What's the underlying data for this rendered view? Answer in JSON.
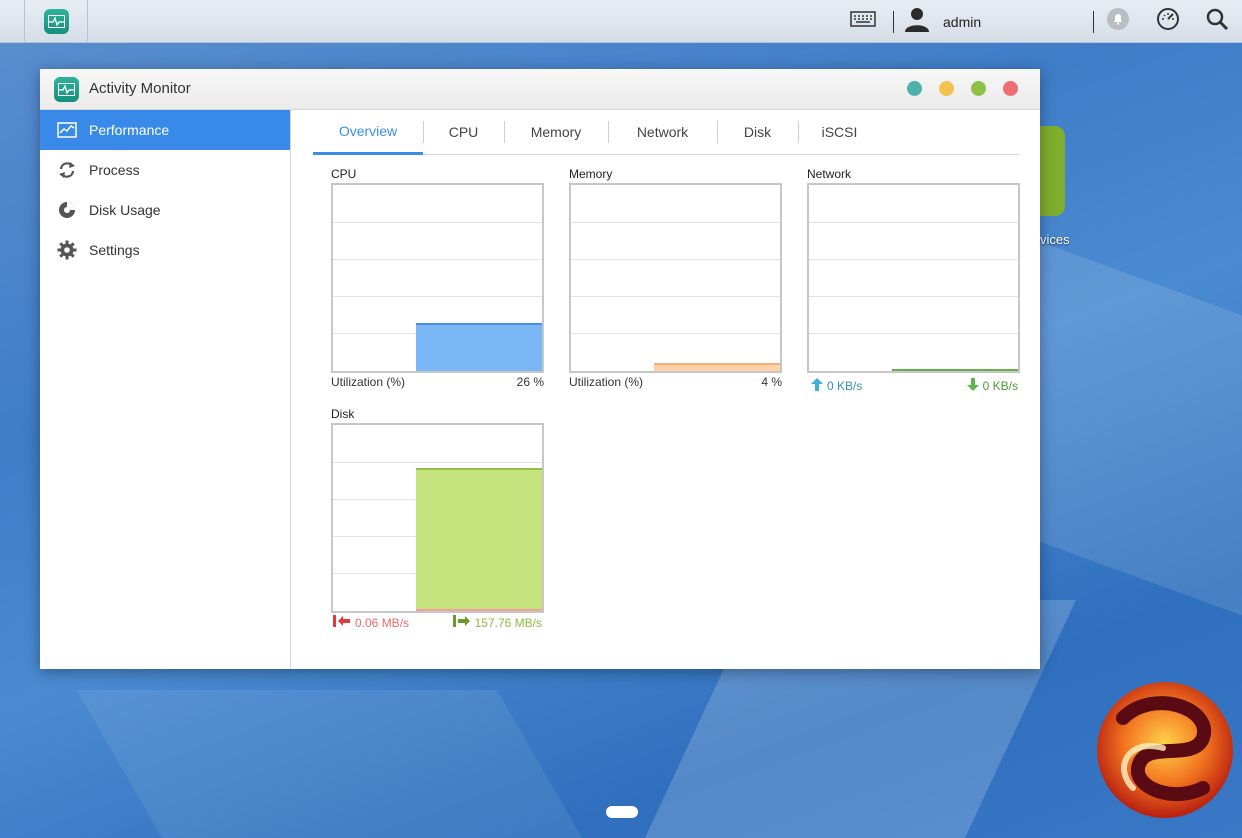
{
  "topbar": {
    "username": "admin",
    "icons": [
      "activity-monitor-app-icon",
      "keyboard-icon",
      "user-icon",
      "notification-icon",
      "dashboard-gauge-icon",
      "search-icon"
    ]
  },
  "window": {
    "title": "Activity Monitor",
    "controls": [
      {
        "name": "info",
        "color": "#4fb1aa"
      },
      {
        "name": "minimize",
        "color": "#f2c14e"
      },
      {
        "name": "maximize",
        "color": "#8fc04a"
      },
      {
        "name": "close",
        "color": "#ec6f72"
      }
    ]
  },
  "sidebar": {
    "items": [
      {
        "label": "Performance",
        "icon": "performance-chart-icon",
        "active": true
      },
      {
        "label": "Process",
        "icon": "process-cycle-icon",
        "active": false
      },
      {
        "label": "Disk Usage",
        "icon": "disk-usage-pie-icon",
        "active": false
      },
      {
        "label": "Settings",
        "icon": "gear-icon",
        "active": false
      }
    ]
  },
  "tabs": [
    {
      "label": "Overview",
      "active": true
    },
    {
      "label": "CPU",
      "active": false
    },
    {
      "label": "Memory",
      "active": false
    },
    {
      "label": "Network",
      "active": false
    },
    {
      "label": "Disk",
      "active": false
    },
    {
      "label": "iSCSI",
      "active": false
    }
  ],
  "panels": {
    "cpu": {
      "title": "CPU",
      "footer_label": "Utilization (%)",
      "footer_value": "26 %"
    },
    "memory": {
      "title": "Memory",
      "footer_label": "Utilization (%)",
      "footer_value": "4 %"
    },
    "network": {
      "title": "Network",
      "upload": "0 KB/s",
      "download": "0 KB/s"
    },
    "disk": {
      "title": "Disk",
      "read": "0.06 MB/s",
      "write": "157.76 MB/s"
    }
  },
  "colors": {
    "accent": "#3889e8",
    "cpu": "#7ab6f5",
    "memory": "#ffd1a6",
    "network_up": "#3fb0d8",
    "network_down": "#64b04a",
    "disk_read": "#e96a6a",
    "disk_write": "#c5e37d"
  },
  "chart_data": [
    {
      "type": "area",
      "title": "CPU",
      "ylabel": "Utilization (%)",
      "ylim": [
        0,
        100
      ],
      "values": [
        26
      ]
    },
    {
      "type": "area",
      "title": "Memory",
      "ylabel": "Utilization (%)",
      "ylim": [
        0,
        100
      ],
      "values": [
        4
      ]
    },
    {
      "type": "area",
      "title": "Network",
      "series": [
        {
          "name": "upload",
          "values": [
            0
          ]
        },
        {
          "name": "download",
          "values": [
            0
          ]
        }
      ]
    },
    {
      "type": "area",
      "title": "Disk",
      "series": [
        {
          "name": "read",
          "values": [
            0.06
          ]
        },
        {
          "name": "write",
          "values": [
            157.76
          ]
        }
      ],
      "write_fraction_of_plot": 0.77
    }
  ]
}
